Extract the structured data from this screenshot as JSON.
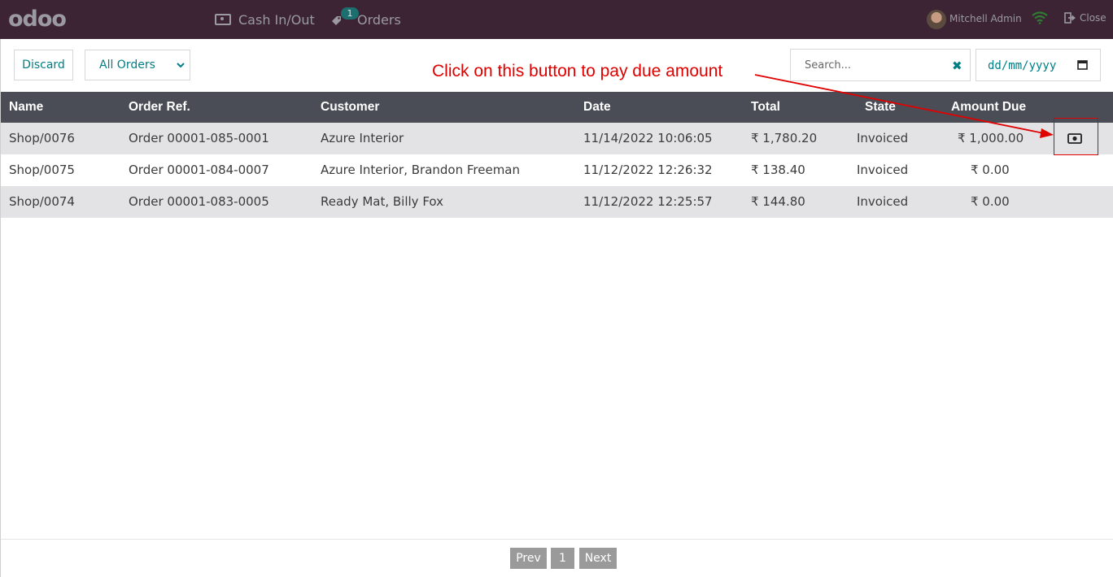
{
  "header": {
    "logo": "odoo",
    "cash_label": "Cash In/Out",
    "orders_label": "Orders",
    "orders_badge": "1",
    "user_name": "Mitchell Admin",
    "close_label": "Close"
  },
  "controls": {
    "discard_label": "Discard",
    "filter_selected": "All Orders",
    "search_placeholder": "Search...",
    "date_placeholder": "dd/mm/yyyy"
  },
  "annotation": {
    "text": "Click on this button to pay due amount",
    "color": "#e00000"
  },
  "table": {
    "columns": {
      "name": "Name",
      "ref": "Order Ref.",
      "customer": "Customer",
      "date": "Date",
      "total": "Total",
      "state": "State",
      "due": "Amount Due"
    },
    "rows": [
      {
        "name": "Shop/0076",
        "ref": "Order 00001-085-0001",
        "customer": "Azure Interior",
        "date": "11/14/2022 10:06:05",
        "total": "₹ 1,780.20",
        "state": "Invoiced",
        "due": "₹ 1,000.00",
        "action_icon": "cash-icon"
      },
      {
        "name": "Shop/0075",
        "ref": "Order 00001-084-0007",
        "customer": "Azure Interior, Brandon Freeman",
        "date": "11/12/2022 12:26:32",
        "total": "₹ 138.40",
        "state": "Invoiced",
        "due": "₹ 0.00"
      },
      {
        "name": "Shop/0074",
        "ref": "Order 00001-083-0005",
        "customer": "Ready Mat, Billy Fox",
        "date": "11/12/2022 12:25:57",
        "total": "₹ 144.80",
        "state": "Invoiced",
        "due": "₹ 0.00"
      }
    ]
  },
  "pagination": {
    "prev_label": "Prev",
    "page": "1",
    "next_label": "Next"
  },
  "colors": {
    "topbar": "#3c2435",
    "accent": "#017e84",
    "table_header": "#4a4d56"
  }
}
